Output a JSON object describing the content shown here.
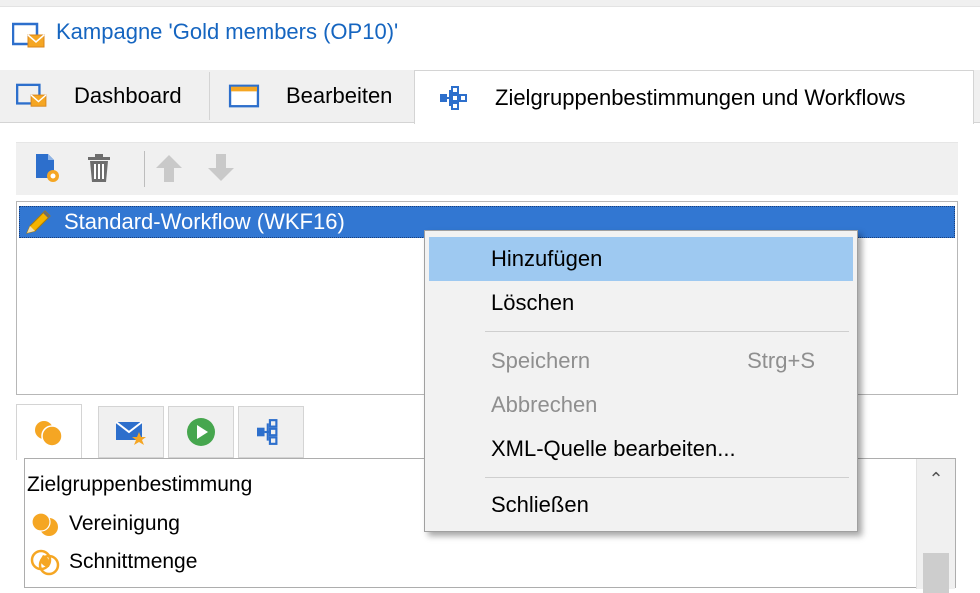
{
  "window": {
    "title": "Kampagne 'Gold members (OP10)'",
    "title_icon": "campaign-icon",
    "title_color": "#1565c0"
  },
  "tabs": [
    {
      "label": "Dashboard",
      "icon": "campaign-icon"
    },
    {
      "label": "Bearbeiten",
      "icon": "window-icon"
    },
    {
      "label": "Zielgruppenbestimmungen und Workflows",
      "icon": "workflow-icon",
      "active": true
    }
  ],
  "toolbar": {
    "buttons": [
      {
        "icon": "new-workflow-icon",
        "enabled": true
      },
      {
        "icon": "trash-icon",
        "enabled": true
      },
      {
        "icon": "arrow-up-icon",
        "enabled": false
      },
      {
        "icon": "arrow-down-icon",
        "enabled": false
      }
    ]
  },
  "workflow_list": {
    "items": [
      {
        "label": "Standard-Workflow (WKF16)",
        "icon": "pencil-icon",
        "selected": true
      }
    ],
    "selection_color": "#3277d2"
  },
  "context_menu": {
    "items": [
      {
        "label": "Hinzufügen",
        "shortcut": "",
        "enabled": true,
        "highlighted": true
      },
      {
        "label": "Löschen",
        "shortcut": "",
        "enabled": true
      },
      {
        "label": "Speichern",
        "shortcut": "Strg+S",
        "enabled": false
      },
      {
        "label": "Abbrechen",
        "shortcut": "",
        "enabled": false
      },
      {
        "label": "XML-Quelle bearbeiten...",
        "shortcut": "",
        "enabled": true
      },
      {
        "label": "Schließen",
        "shortcut": "",
        "enabled": true
      }
    ],
    "highlight_color": "#9ec9f1"
  },
  "bottom_tabs": [
    {
      "icon": "targeting-icon",
      "active": true
    },
    {
      "icon": "delivery-icon"
    },
    {
      "icon": "play-icon"
    },
    {
      "icon": "workflow-icon"
    }
  ],
  "activity_tree": {
    "header": "Zielgruppenbestimmung",
    "items": [
      {
        "label": "Vereinigung",
        "icon": "union-icon"
      },
      {
        "label": "Schnittmenge",
        "icon": "intersection-icon"
      }
    ]
  }
}
